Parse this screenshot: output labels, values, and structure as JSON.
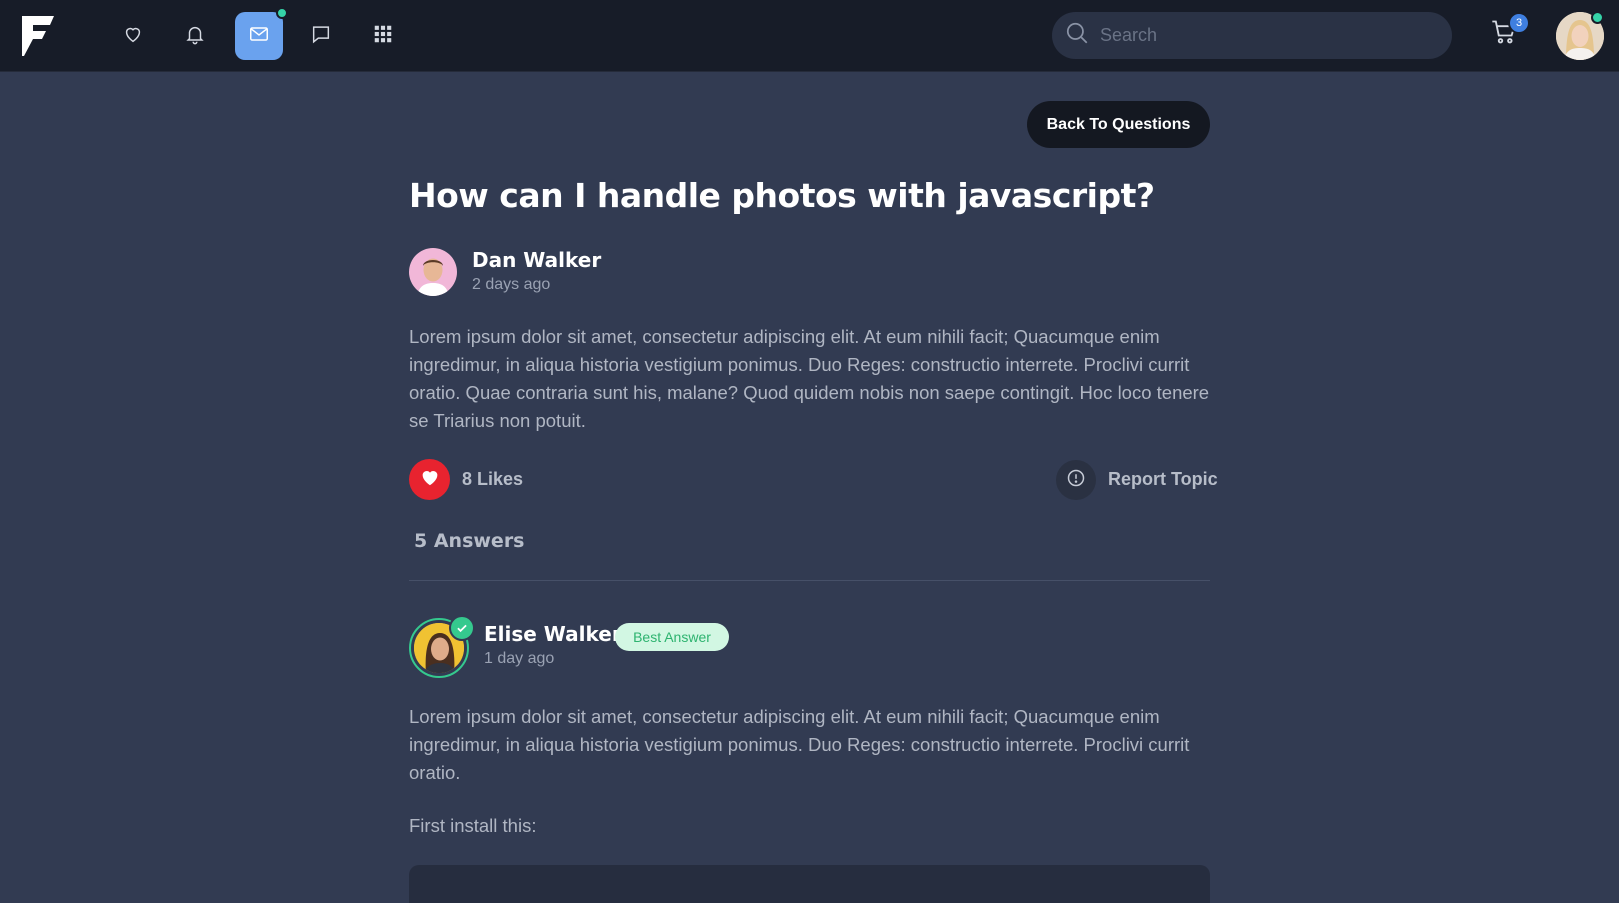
{
  "navbar": {
    "logo_icon": "brand-logo-icon",
    "icons": [
      {
        "name": "heart-icon",
        "active": false
      },
      {
        "name": "bell-icon",
        "active": false
      },
      {
        "name": "mail-icon",
        "active": true,
        "has_dot": true
      },
      {
        "name": "message-icon",
        "active": false
      },
      {
        "name": "apps-grid-icon",
        "active": false
      }
    ],
    "search": {
      "placeholder": "Search",
      "value": ""
    },
    "cart": {
      "icon": "cart-icon",
      "count": "3"
    },
    "user_avatar_online": true
  },
  "back_button_label": "Back To Questions",
  "question": {
    "title": "How can I handle photos with javascript?",
    "author": {
      "name": "Dan Walker",
      "time": "2 days ago"
    },
    "body": "Lorem ipsum dolor sit amet, consectetur adipiscing elit. At eum nihili facit; Quacumque enim ingredimur, in aliqua historia vestigium ponimus. Duo Reges: constructio interrete. Proclivi currit oratio. Quae contraria sunt his, malane? Quod quidem nobis non saepe contingit. Hoc loco tenere se Triarius non potuit.",
    "likes_label": "8 Likes",
    "report_label": "Report Topic"
  },
  "answers_count_label": "5 Answers",
  "answer": {
    "author": {
      "name": "Elise Walker",
      "time": "1 day ago"
    },
    "badge": "Best Answer",
    "body": "Lorem ipsum dolor sit amet, consectetur adipiscing elit. At eum nihili facit; Quacumque enim ingredimur, in aliqua historia vestigium ponimus. Duo Reges: constructio interrete. Proclivi currit oratio.",
    "install_text": "First install this:"
  },
  "colors": {
    "background": "#323b52",
    "navbar": "#171c28",
    "accent_blue": "#6aa2ee",
    "like_red": "#e8232f",
    "success_green": "#35c98e"
  }
}
